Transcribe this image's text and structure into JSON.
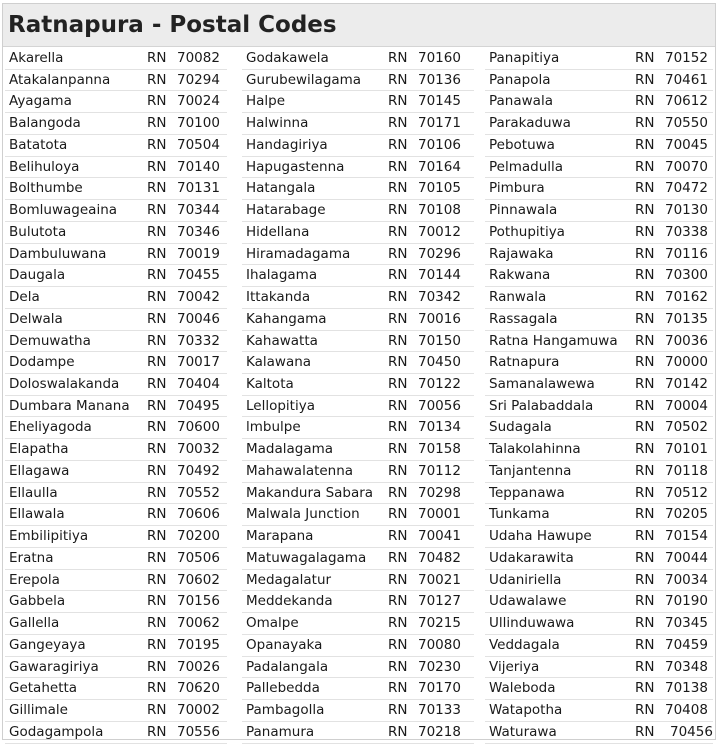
{
  "title": "Ratnapura - Postal Codes",
  "columns": [
    [
      {
        "name": "Akarella",
        "region": "RN",
        "code": "70082"
      },
      {
        "name": "Atakalanpanna",
        "region": "RN",
        "code": "70294"
      },
      {
        "name": "Ayagama",
        "region": "RN",
        "code": "70024"
      },
      {
        "name": "Balangoda",
        "region": "RN",
        "code": "70100"
      },
      {
        "name": "Batatota",
        "region": "RN",
        "code": "70504"
      },
      {
        "name": "Belihuloya",
        "region": "RN",
        "code": "70140"
      },
      {
        "name": "Bolthumbe",
        "region": "RN",
        "code": "70131"
      },
      {
        "name": "Bomluwageaina",
        "region": "RN",
        "code": "70344"
      },
      {
        "name": "Bulutota",
        "region": "RN",
        "code": "70346"
      },
      {
        "name": "Dambuluwana",
        "region": "RN",
        "code": "70019"
      },
      {
        "name": "Daugala",
        "region": "RN",
        "code": "70455"
      },
      {
        "name": "Dela",
        "region": "RN",
        "code": "70042"
      },
      {
        "name": "Delwala",
        "region": "RN",
        "code": "70046"
      },
      {
        "name": "Demuwatha",
        "region": "RN",
        "code": "70332"
      },
      {
        "name": "Dodampe",
        "region": "RN",
        "code": "70017"
      },
      {
        "name": "Doloswalakanda",
        "region": "RN",
        "code": "70404"
      },
      {
        "name": "Dumbara Manana",
        "region": "RN",
        "code": "70495"
      },
      {
        "name": "Eheliyagoda",
        "region": "RN",
        "code": "70600"
      },
      {
        "name": "Elapatha",
        "region": "RN",
        "code": "70032"
      },
      {
        "name": "Ellagawa",
        "region": "RN",
        "code": "70492"
      },
      {
        "name": "Ellaulla",
        "region": "RN",
        "code": "70552"
      },
      {
        "name": "Ellawala",
        "region": "RN",
        "code": "70606"
      },
      {
        "name": "Embilipitiya",
        "region": "RN",
        "code": "70200"
      },
      {
        "name": "Eratna",
        "region": "RN",
        "code": "70506"
      },
      {
        "name": "Erepola",
        "region": "RN",
        "code": "70602"
      },
      {
        "name": "Gabbela",
        "region": "RN",
        "code": "70156"
      },
      {
        "name": "Gallella",
        "region": "RN",
        "code": "70062"
      },
      {
        "name": "Gangeyaya",
        "region": "RN",
        "code": "70195"
      },
      {
        "name": "Gawaragiriya",
        "region": "RN",
        "code": "70026"
      },
      {
        "name": "Getahetta",
        "region": "RN",
        "code": "70620"
      },
      {
        "name": "Gillimale",
        "region": "RN",
        "code": "70002"
      },
      {
        "name": "Godagampola",
        "region": "RN",
        "code": "70556"
      }
    ],
    [
      {
        "name": "Godakawela",
        "region": "RN",
        "code": "70160"
      },
      {
        "name": "Gurubewilagama",
        "region": "RN",
        "code": "70136"
      },
      {
        "name": "Halpe",
        "region": "RN",
        "code": "70145"
      },
      {
        "name": "Halwinna",
        "region": "RN",
        "code": "70171"
      },
      {
        "name": "Handagiriya",
        "region": "RN",
        "code": "70106"
      },
      {
        "name": "Hapugastenna",
        "region": "RN",
        "code": "70164"
      },
      {
        "name": "Hatangala",
        "region": "RN",
        "code": "70105"
      },
      {
        "name": "Hatarabage",
        "region": "RN",
        "code": "70108"
      },
      {
        "name": "Hidellana",
        "region": "RN",
        "code": "70012"
      },
      {
        "name": "Hiramadagama",
        "region": "RN",
        "code": "70296"
      },
      {
        "name": "Ihalagama",
        "region": "RN",
        "code": "70144"
      },
      {
        "name": "Ittakanda",
        "region": "RN",
        "code": "70342"
      },
      {
        "name": "Kahangama",
        "region": "RN",
        "code": "70016"
      },
      {
        "name": "Kahawatta",
        "region": "RN",
        "code": "70150"
      },
      {
        "name": "Kalawana",
        "region": "RN",
        "code": "70450"
      },
      {
        "name": "Kaltota",
        "region": "RN",
        "code": "70122"
      },
      {
        "name": "Lellopitiya",
        "region": "RN",
        "code": "70056"
      },
      {
        "name": "lmbulpe",
        "region": "RN",
        "code": "70134"
      },
      {
        "name": "Madalagama",
        "region": "RN",
        "code": "70158"
      },
      {
        "name": "Mahawalatenna",
        "region": "RN",
        "code": "70112"
      },
      {
        "name": "Makandura Sabara",
        "region": "RN",
        "code": "70298"
      },
      {
        "name": "Malwala Junction",
        "region": "RN",
        "code": "70001"
      },
      {
        "name": "Marapana",
        "region": "RN",
        "code": "70041"
      },
      {
        "name": "Matuwagalagama",
        "region": "RN",
        "code": "70482"
      },
      {
        "name": "Medagalatur",
        "region": "RN",
        "code": "70021"
      },
      {
        "name": "Meddekanda",
        "region": "RN",
        "code": "70127"
      },
      {
        "name": "Omalpe",
        "region": "RN",
        "code": "70215"
      },
      {
        "name": "Opanayaka",
        "region": "RN",
        "code": "70080"
      },
      {
        "name": "Padalangala",
        "region": "RN",
        "code": "70230"
      },
      {
        "name": "Pallebedda",
        "region": "RN",
        "code": "70170"
      },
      {
        "name": "Pambagolla",
        "region": "RN",
        "code": "70133"
      },
      {
        "name": "Panamura",
        "region": "RN",
        "code": "70218"
      }
    ],
    [
      {
        "name": "Panapitiya",
        "region": "RN",
        "code": "70152"
      },
      {
        "name": "Panapola",
        "region": "RN",
        "code": "70461"
      },
      {
        "name": "Panawala",
        "region": "RN",
        "code": "70612"
      },
      {
        "name": "Parakaduwa",
        "region": "RN",
        "code": "70550"
      },
      {
        "name": "Pebotuwa",
        "region": "RN",
        "code": "70045"
      },
      {
        "name": "Pelmadulla",
        "region": "RN",
        "code": "70070"
      },
      {
        "name": "Pimbura",
        "region": "RN",
        "code": "70472"
      },
      {
        "name": "Pinnawala",
        "region": "RN",
        "code": "70130"
      },
      {
        "name": "Pothupitiya",
        "region": "RN",
        "code": "70338"
      },
      {
        "name": "Rajawaka",
        "region": "RN",
        "code": "70116"
      },
      {
        "name": "Rakwana",
        "region": "RN",
        "code": "70300"
      },
      {
        "name": "Ranwala",
        "region": "RN",
        "code": "70162"
      },
      {
        "name": "Rassagala",
        "region": "RN",
        "code": "70135"
      },
      {
        "name": "Ratna Hangamuwa",
        "region": "RN",
        "code": "70036"
      },
      {
        "name": "Ratnapura",
        "region": "RN",
        "code": "70000"
      },
      {
        "name": "Samanalawewa",
        "region": "RN",
        "code": "70142"
      },
      {
        "name": "Sri Palabaddala",
        "region": "RN",
        "code": "70004"
      },
      {
        "name": "Sudagala",
        "region": "RN",
        "code": "70502"
      },
      {
        "name": "Talakolahinna",
        "region": "RN",
        "code": "70101"
      },
      {
        "name": "Tanjantenna",
        "region": "RN",
        "code": "70118"
      },
      {
        "name": "Teppanawa",
        "region": "RN",
        "code": "70512"
      },
      {
        "name": "Tunkama",
        "region": "RN",
        "code": "70205"
      },
      {
        "name": "Udaha Hawupe",
        "region": "RN",
        "code": "70154"
      },
      {
        "name": "Udakarawita",
        "region": "RN",
        "code": "70044"
      },
      {
        "name": "Udaniriella",
        "region": "RN",
        "code": "70034"
      },
      {
        "name": "Udawalawe",
        "region": "RN",
        "code": "70190"
      },
      {
        "name": "Ullinduwawa",
        "region": "RN",
        "code": "70345"
      },
      {
        "name": "Veddagala",
        "region": "RN",
        "code": "70459"
      },
      {
        "name": "Vijeriya",
        "region": "RN",
        "code": "70348"
      },
      {
        "name": "Waleboda",
        "region": "RN",
        "code": "70138"
      },
      {
        "name": "Watapotha",
        "region": "RN",
        "code": "70408"
      },
      {
        "name": "Waturawa",
        "region": "RN",
        "code": "70456"
      }
    ]
  ]
}
